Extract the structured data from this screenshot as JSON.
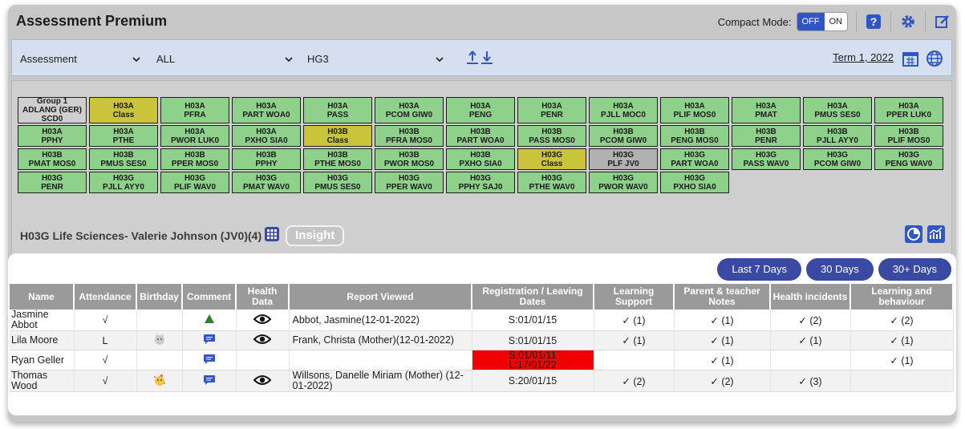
{
  "app": {
    "title": "Assessment Premium"
  },
  "compact_mode": {
    "label": "Compact Mode:",
    "off": "OFF",
    "on": "ON",
    "selected": "OFF"
  },
  "toolbar_icons": [
    "help-icon",
    "settings-icon",
    "edit-icon"
  ],
  "filters": {
    "assessment": "Assessment",
    "scope": "ALL",
    "group": "HG3",
    "term": "Term 1, 2022"
  },
  "groups_row1": [
    {
      "l1": "Group 1",
      "l2": "ADLANG (GER)",
      "l3": "SCD0",
      "style": "grey"
    },
    {
      "l1": "H03A",
      "l2": "Class",
      "style": "yellow"
    },
    {
      "l1": "H03A",
      "l2": "PFRA",
      "style": "green"
    },
    {
      "l1": "H03A",
      "l2": "PART WOA0",
      "style": "green"
    },
    {
      "l1": "H03A",
      "l2": "PASS",
      "style": "green"
    },
    {
      "l1": "H03A",
      "l2": "PCOM GIW0",
      "style": "green"
    },
    {
      "l1": "H03A",
      "l2": "PENG",
      "style": "green"
    },
    {
      "l1": "H03A",
      "l2": "PENR",
      "style": "green"
    },
    {
      "l1": "H03A",
      "l2": "PJLL MOC0",
      "style": "green"
    },
    {
      "l1": "H03A",
      "l2": "PLIF MOS0",
      "style": "green"
    },
    {
      "l1": "H03A",
      "l2": "PMAT",
      "style": "green"
    },
    {
      "l1": "H03A",
      "l2": "PMUS SES0",
      "style": "green"
    },
    {
      "l1": "H03A",
      "l2": "PPER LUK0",
      "style": "green"
    }
  ],
  "groups_rest": [
    {
      "l1": "H03A",
      "l2": "PPHY",
      "style": "green"
    },
    {
      "l1": "H03A",
      "l2": "PTHE",
      "style": "green"
    },
    {
      "l1": "H03A",
      "l2": "PWOR LUK0",
      "style": "green"
    },
    {
      "l1": "H03A",
      "l2": "PXHO SIA0",
      "style": "green"
    },
    {
      "l1": "H03B",
      "l2": "Class",
      "style": "yellow"
    },
    {
      "l1": "H03B",
      "l2": "PFRA MOS0",
      "style": "green"
    },
    {
      "l1": "H03B",
      "l2": "PART WOA0",
      "style": "green"
    },
    {
      "l1": "H03B",
      "l2": "PASS MOS0",
      "style": "green"
    },
    {
      "l1": "H03B",
      "l2": "PCOM GIW0",
      "style": "green"
    },
    {
      "l1": "H03B",
      "l2": "PENG MOS0",
      "style": "green"
    },
    {
      "l1": "H03B",
      "l2": "PENR",
      "style": "green"
    },
    {
      "l1": "H03B",
      "l2": "PJLL AYY0",
      "style": "green"
    },
    {
      "l1": "H03B",
      "l2": "PLIF MOS0",
      "style": "green"
    },
    {
      "l1": "H03B",
      "l2": "PMAT MOS0",
      "style": "green"
    },
    {
      "l1": "H03B",
      "l2": "PMUS SES0",
      "style": "green"
    },
    {
      "l1": "H03B",
      "l2": "PPER MOS0",
      "style": "green"
    },
    {
      "l1": "H03B",
      "l2": "PPHY",
      "style": "green"
    },
    {
      "l1": "H03B",
      "l2": "PTHE MOS0",
      "style": "green"
    },
    {
      "l1": "H03B",
      "l2": "PWOR MOS0",
      "style": "green"
    },
    {
      "l1": "H03B",
      "l2": "PXHO SIA0",
      "style": "green"
    },
    {
      "l1": "H03G",
      "l2": "Class",
      "style": "yellow"
    },
    {
      "l1": "H03G",
      "l2": "PLF JV0",
      "style": "selected"
    },
    {
      "l1": "H03G",
      "l2": "PART WOA0",
      "style": "green"
    },
    {
      "l1": "H03G",
      "l2": "PASS WAV0",
      "style": "green"
    },
    {
      "l1": "H03G",
      "l2": "PCOM GIW0",
      "style": "green"
    },
    {
      "l1": "H03G",
      "l2": "PENG WAV0",
      "style": "green"
    },
    {
      "l1": "H03G",
      "l2": "PENR",
      "style": "green"
    },
    {
      "l1": "H03G",
      "l2": "PJLL AYY0",
      "style": "green"
    },
    {
      "l1": "H03G",
      "l2": "PLIF WAV0",
      "style": "green"
    },
    {
      "l1": "H03G",
      "l2": "PMAT WAV0",
      "style": "green"
    },
    {
      "l1": "H03G",
      "l2": "PMUS SES0",
      "style": "green"
    },
    {
      "l1": "H03G",
      "l2": "PPER WAV0",
      "style": "green"
    },
    {
      "l1": "H03G",
      "l2": "PPHY SAJ0",
      "style": "green"
    },
    {
      "l1": "H03G",
      "l2": "PTHE WAV0",
      "style": "green"
    },
    {
      "l1": "H03G",
      "l2": "PWOR WAV0",
      "style": "green"
    },
    {
      "l1": "H03G",
      "l2": "PXHO SIA0",
      "style": "green"
    }
  ],
  "teacher_label": "H03G Life Sciences- Valerie Johnson (JV0)(4)",
  "insight_label": "Insight",
  "day_buttons": [
    "Last 7 Days",
    "30 Days",
    "30+ Days"
  ],
  "table": {
    "headers": [
      "Name",
      "Attendance",
      "Birthday",
      "Comment",
      "Health Data",
      "Report Viewed",
      "Registration / Leaving Dates",
      "Learning Support",
      "Parent & teacher Notes",
      "Health incidents",
      "Learning and behaviour"
    ],
    "rows": [
      {
        "name": "Jasmine Abbot",
        "attendance": "√",
        "birthday": "",
        "comment": "tree",
        "health": true,
        "report": "Abbot, Jasmine(12-01-2022)",
        "reg": "S:01/01/15",
        "reg_red": false,
        "ls": "✓ (1)",
        "ptn": "✓ (1)",
        "hi": "✓ (2)",
        "lb": "✓ (2)"
      },
      {
        "name": "Lila Moore",
        "attendance": "L",
        "birthday": "cat",
        "comment": "chat",
        "health": true,
        "report": "Frank, Christa (Mother)(12-01-2022)",
        "reg": "S:01/01/15",
        "reg_red": false,
        "ls": "✓ (1)",
        "ptn": "✓ (1)",
        "hi": "✓ (1)",
        "lb": "✓ (1)"
      },
      {
        "name": "Ryan Geller",
        "attendance": "√",
        "birthday": "",
        "comment": "chat",
        "health": false,
        "report": "",
        "reg": "S:01/01/11",
        "reg2": "L:17/01/22",
        "reg_red": true,
        "ls": "",
        "ptn": "✓ (1)",
        "hi": "",
        "lb": "✓ (1)"
      },
      {
        "name": "Thomas Wood",
        "attendance": "√",
        "birthday": "party",
        "comment": "chat",
        "health": true,
        "report": "Willsons, Danelle Miriam (Mother) (12-01-2022)",
        "reg": "S:20/01/15",
        "reg_red": false,
        "ls": "✓ (2)",
        "ptn": "✓ (2)",
        "hi": "✓ (3)",
        "lb": ""
      }
    ]
  },
  "colors": {
    "accent": "#3a4aa3",
    "toggle_on": "#2f56c4",
    "group_green": "#8ed18a",
    "group_yellow": "#c9c43a",
    "alert_red": "#f00000"
  }
}
